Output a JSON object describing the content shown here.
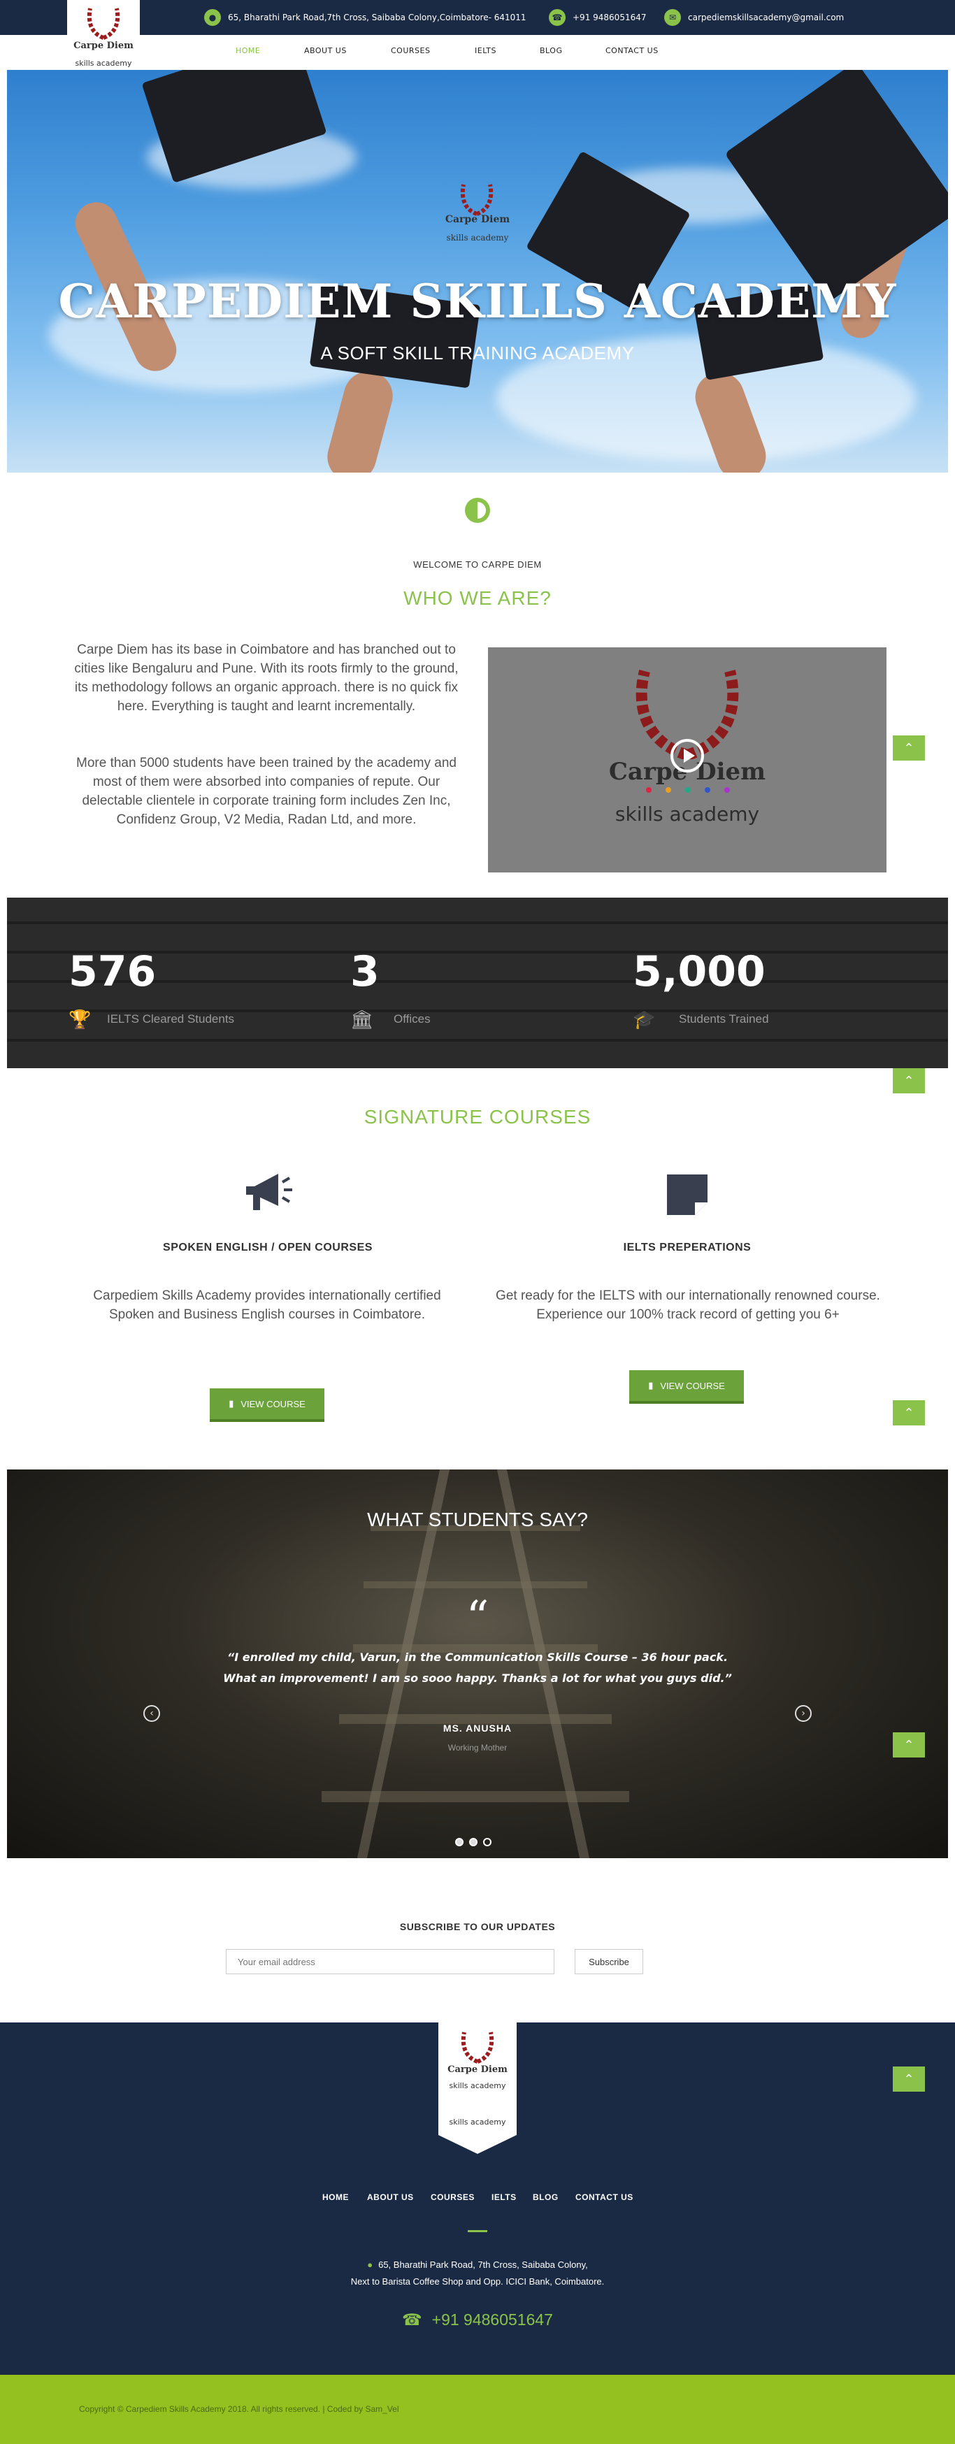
{
  "colors": {
    "navy": "#1b2a44",
    "green": "#8bc34a",
    "lime": "#94c11f",
    "logo_red": "#9b1c1c"
  },
  "topbar": {
    "address": "65, Bharathi Park Road,7th Cross, Saibaba Colony,Coimbatore- 641011",
    "phone": "+91 9486051647",
    "email": "carpediemskillsacademy@gmail.com",
    "icons": [
      "location-icon",
      "phone-icon",
      "mail-icon"
    ]
  },
  "logo": {
    "line1": "Carpe Diem",
    "line2": "skills academy"
  },
  "nav": [
    "HOME",
    "ABOUT US",
    "COURSES",
    "IELTS",
    "BLOG",
    "CONTACT US"
  ],
  "hero": {
    "logo_line1": "Carpe Diem",
    "logo_line2": "skills academy",
    "title": "CARPEDIEM SKILLS ACADEMY",
    "subtitle": "A SOFT SKILL TRAINING ACADEMY"
  },
  "about": {
    "kicker": "WELCOME TO CARPE DIEM",
    "title": "WHO WE ARE?",
    "para1": "Carpe Diem has its base in Coimbatore and has branched out to cities like Bengaluru and Pune. With its roots firmly to the ground, its methodology follows an organic approach. there is no quick fix here. Everything is taught and learnt incrementally.",
    "para2": "More than 5000 students have been trained by the academy and most of them were absorbed into companies of repute. Our delectable clientele in corporate training form includes Zen Inc, Confidenz Group, V2 Media, Radan Ltd, and more.",
    "video_logo_line1": "Carpe Diem",
    "video_logo_line2": "skills academy"
  },
  "stats": [
    {
      "number": "576",
      "label": "IELTS Cleared Students",
      "icon": "trophy-icon"
    },
    {
      "number": "3",
      "label": "Offices",
      "icon": "institution-icon"
    },
    {
      "number": "5,000",
      "label": "Students Trained",
      "icon": "graduation-cap-icon"
    }
  ],
  "courses": {
    "title": "SIGNATURE COURSES",
    "items": [
      {
        "icon": "megaphone-icon",
        "name": "SPOKEN ENGLISH / OPEN COURSES",
        "desc": "Carpediem Skills Academy provides internationally certified Spoken and Business English courses in Coimbatore.",
        "button": "VIEW COURSE"
      },
      {
        "icon": "sticky-note-icon",
        "name": "IELTS PREPERATIONS",
        "desc": "Get ready for the IELTS with our internationally renowned course. Experience our 100% track record of getting you 6+",
        "button": "VIEW COURSE"
      }
    ]
  },
  "testimonials": {
    "title": "WHAT STUDENTS SAY?",
    "quote": "“I enrolled my child, Varun, in the Communication Skills Course – 36 hour pack. What an improvement! I am so sooo happy. Thanks a lot for what you guys did.”",
    "author": "MS. ANUSHA",
    "role": "Working Mother",
    "active_slide": 2,
    "slide_count": 3
  },
  "subscribe": {
    "title": "SUBSCRIBE TO OUR UPDATES",
    "placeholder": "Your email address",
    "button": "Subscribe"
  },
  "footer": {
    "nav": [
      "HOME",
      "ABOUT US",
      "COURSES",
      "IELTS",
      "BLOG",
      "CONTACT US"
    ],
    "address1": "65, Bharathi Park Road, 7th Cross, Saibaba Colony,",
    "address2": "Next to Barista Coffee Shop and Opp. ICICI Bank, Coimbatore.",
    "phone": "+91 9486051647",
    "copyright": "Copyright © Carpediem Skills Academy 2018. All rights reserved. | Coded by Sam_Vel"
  }
}
